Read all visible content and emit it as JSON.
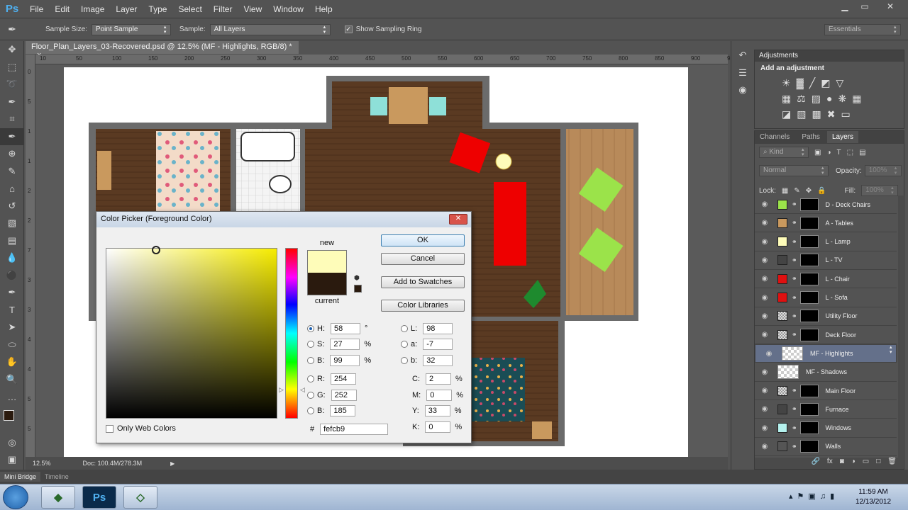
{
  "app": {
    "logo": "Ps"
  },
  "menu": [
    "File",
    "Edit",
    "Image",
    "Layer",
    "Type",
    "Select",
    "Filter",
    "View",
    "Window",
    "Help"
  ],
  "window_controls": {
    "minimize": "▁",
    "restore": "▭",
    "close": "✕"
  },
  "options": {
    "sample_size_label": "Sample Size:",
    "sample_size_value": "Point Sample",
    "sample_label": "Sample:",
    "sample_value": "All Layers",
    "show_ring_label": "Show Sampling Ring",
    "workspace": "Essentials"
  },
  "document": {
    "tab_title": "Floor_Plan_Layers_03-Recovered.psd @ 12.5% (MF - Highlights, RGB/8) *",
    "tab_close": "×",
    "zoom": "12.5%",
    "doc_size": "Doc: 100.4M/278.3M",
    "ruler_marks": [
      "10",
      "50",
      "100",
      "150",
      "200",
      "250",
      "300",
      "350",
      "400",
      "450",
      "500",
      "550",
      "600",
      "650",
      "700",
      "750",
      "800",
      "850",
      "900",
      "950"
    ],
    "ruler_v_marks": [
      "0",
      "5",
      "1",
      "1",
      "2",
      "2",
      "7",
      "3",
      "3",
      "4",
      "4",
      "5",
      "5"
    ]
  },
  "bottom_tabs": [
    "Mini Bridge",
    "Timeline"
  ],
  "adjustments": {
    "tab": "Adjustments",
    "subtitle": "Add an adjustment"
  },
  "layers_panel": {
    "tabs": [
      "Channels",
      "Paths",
      "Layers"
    ],
    "kind_label": "Kind",
    "blend_mode": "Normal",
    "opacity_label": "Opacity:",
    "opacity_value": "100%",
    "lock_label": "Lock:",
    "fill_label": "Fill:",
    "fill_value": "100%",
    "layers": [
      {
        "name": "D - Deck Chairs",
        "swatch": "#9be34a"
      },
      {
        "name": "A - Tables",
        "swatch": "#c9995e"
      },
      {
        "name": "L - Lamp",
        "swatch": "#fefcb9"
      },
      {
        "name": "L - TV",
        "swatch": "#444444"
      },
      {
        "name": "L - Chair",
        "swatch": "#e01010"
      },
      {
        "name": "L - Sofa",
        "swatch": "#e01010"
      },
      {
        "name": "Utility Floor",
        "swatch": "pattern"
      },
      {
        "name": "Deck Floor",
        "swatch": "pattern"
      },
      {
        "name": "MF - Highlights",
        "swatch": "none",
        "selected": true
      },
      {
        "name": "MF - Shadows",
        "swatch": "none"
      },
      {
        "name": "Main Floor",
        "swatch": "pattern"
      },
      {
        "name": "Furnace",
        "swatch": "#444444"
      },
      {
        "name": "Windows",
        "swatch": "#b5f2ee"
      },
      {
        "name": "Walls",
        "swatch": "#555555"
      }
    ]
  },
  "color_picker": {
    "title": "Color Picker (Foreground Color)",
    "close": "✕",
    "new_label": "new",
    "current_label": "current",
    "new_color": "#fefcb9",
    "current_color": "#2a1a0e",
    "buttons": {
      "ok": "OK",
      "cancel": "Cancel",
      "swatches": "Add to Swatches",
      "libraries": "Color Libraries"
    },
    "hsb": [
      {
        "k": "H:",
        "v": "58",
        "u": "°",
        "on": true
      },
      {
        "k": "S:",
        "v": "27",
        "u": "%"
      },
      {
        "k": "B:",
        "v": "99",
        "u": "%"
      }
    ],
    "rgb": [
      {
        "k": "R:",
        "v": "254"
      },
      {
        "k": "G:",
        "v": "252"
      },
      {
        "k": "B:",
        "v": "185"
      }
    ],
    "lab": [
      {
        "k": "L:",
        "v": "98"
      },
      {
        "k": "a:",
        "v": "-7"
      },
      {
        "k": "b:",
        "v": "32"
      }
    ],
    "cmyk": [
      {
        "k": "C:",
        "v": "2",
        "u": "%"
      },
      {
        "k": "M:",
        "v": "0",
        "u": "%"
      },
      {
        "k": "Y:",
        "v": "33",
        "u": "%"
      },
      {
        "k": "K:",
        "v": "0",
        "u": "%"
      }
    ],
    "hex_label": "#",
    "hex": "fefcb9",
    "only_web_colors": "Only Web Colors",
    "field_color": "#f6ec00"
  },
  "taskbar": {
    "time": "11:59 AM",
    "date": "12/13/2012",
    "ps_label": "Ps"
  }
}
